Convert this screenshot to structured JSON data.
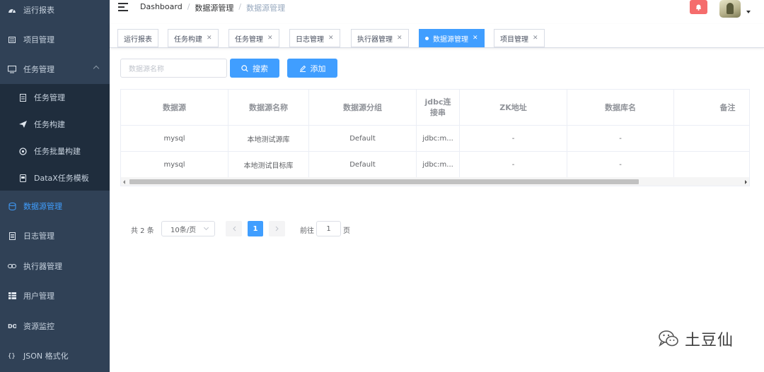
{
  "sidebar": {
    "items": [
      {
        "label": "运行报表",
        "icon": "dashboard-icon"
      },
      {
        "label": "项目管理",
        "icon": "list-icon"
      },
      {
        "label": "任务管理",
        "icon": "monitor-icon"
      },
      {
        "label": "数据源管理",
        "icon": "database-icon"
      },
      {
        "label": "日志管理",
        "icon": "document-icon"
      },
      {
        "label": "执行器管理",
        "icon": "link-icon"
      },
      {
        "label": "用户管理",
        "icon": "table-icon"
      },
      {
        "label": "资源监控",
        "icon": "monitor-eye-icon"
      },
      {
        "label": "JSON 格式化",
        "icon": "braces-icon"
      }
    ],
    "submenu": [
      {
        "label": "任务管理",
        "icon": "file-icon"
      },
      {
        "label": "任务构建",
        "icon": "send-icon"
      },
      {
        "label": "任务批量构建",
        "icon": "settings-icon"
      },
      {
        "label": "DataX任务模板",
        "icon": "template-icon"
      }
    ],
    "active_color": "#409eff"
  },
  "navbar": {
    "breadcrumb": [
      "Dashboard",
      "数据源管理",
      "数据源管理"
    ],
    "notice_icon": "bell-icon"
  },
  "tags": [
    {
      "label": "运行报表",
      "closable": false
    },
    {
      "label": "任务构建",
      "closable": true
    },
    {
      "label": "任务管理",
      "closable": true
    },
    {
      "label": "日志管理",
      "closable": true
    },
    {
      "label": "执行器管理",
      "closable": true
    },
    {
      "label": "数据源管理",
      "closable": true,
      "active": true
    },
    {
      "label": "项目管理",
      "closable": true
    }
  ],
  "filter": {
    "placeholder": "数据源名称",
    "search_label": "搜索",
    "add_label": "添加"
  },
  "table": {
    "columns": [
      "数据源",
      "数据源名称",
      "数据源分组",
      "jdbc连接串",
      "ZK地址",
      "数据库名",
      "备注"
    ],
    "rows": [
      [
        "mysql",
        "本地测试源库",
        "Default",
        "jdbc:m...",
        "-",
        "-",
        ""
      ],
      [
        "mysql",
        "本地测试目标库",
        "Default",
        "jdbc:m...",
        "-",
        "-",
        ""
      ]
    ]
  },
  "pagination": {
    "total": "共 2 条",
    "page_size": "10条/页",
    "current": "1",
    "goto_label": "前往",
    "goto_value": "1",
    "goto_unit": "页"
  },
  "watermark": {
    "text": "土豆仙",
    "icon": "wechat-icon"
  }
}
